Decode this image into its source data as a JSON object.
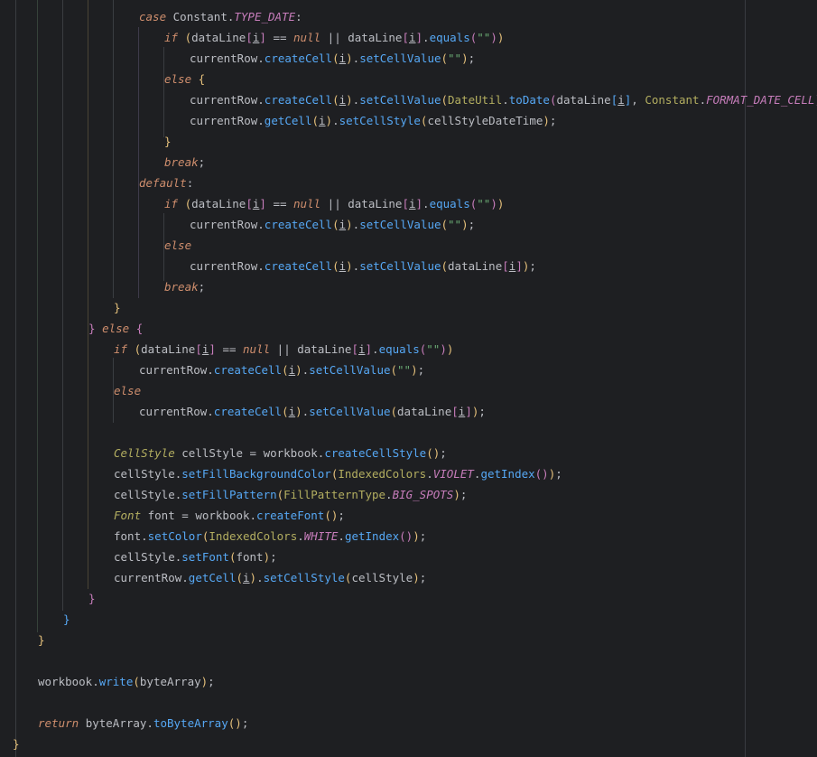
{
  "editor": {
    "language": "java",
    "colors": {
      "background": "#1e1f22",
      "text": "#bcbec4",
      "keyword": "#cf8e6d",
      "method": "#56a8f5",
      "string": "#6aab73",
      "static_field": "#c77dbb"
    },
    "lines": [
      {
        "t": [
          [
            "kwi",
            "case "
          ],
          [
            "cls",
            "Constant."
          ],
          [
            "sfld",
            "TYPE_DATE"
          ],
          [
            "cls",
            ":"
          ]
        ]
      },
      {
        "t": [
          [
            "kwi",
            "if "
          ],
          [
            "br-gold",
            "("
          ],
          [
            "cls",
            "dataLine"
          ],
          [
            "br-purple",
            "["
          ],
          [
            "u",
            "i"
          ],
          [
            "br-purple",
            "]"
          ],
          [
            "cls",
            " == "
          ],
          [
            "null",
            "null"
          ],
          [
            "cls",
            " || dataLine"
          ],
          [
            "br-purple",
            "["
          ],
          [
            "u",
            "i"
          ],
          [
            "br-purple",
            "]"
          ],
          [
            "cls",
            "."
          ],
          [
            "m",
            "equals"
          ],
          [
            "br-purple",
            "("
          ],
          [
            "str",
            "\"\""
          ],
          [
            "br-purple",
            ")"
          ],
          [
            "br-gold",
            ")"
          ]
        ]
      },
      {
        "t": [
          [
            "cls",
            "currentRow."
          ],
          [
            "m",
            "createCell"
          ],
          [
            "br-gold",
            "("
          ],
          [
            "u",
            "i"
          ],
          [
            "br-gold",
            ")"
          ],
          [
            "cls",
            "."
          ],
          [
            "m",
            "setCellValue"
          ],
          [
            "br-gold",
            "("
          ],
          [
            "str",
            "\"\""
          ],
          [
            "br-gold",
            ")"
          ],
          [
            "cls",
            ";"
          ]
        ]
      },
      {
        "t": [
          [
            "kwi",
            "else "
          ],
          [
            "br-gold",
            "{"
          ]
        ]
      },
      {
        "t": [
          [
            "cls",
            "currentRow."
          ],
          [
            "m",
            "createCell"
          ],
          [
            "br-gold",
            "("
          ],
          [
            "u",
            "i"
          ],
          [
            "br-gold",
            ")"
          ],
          [
            "cls",
            "."
          ],
          [
            "m",
            "setCellValue"
          ],
          [
            "br-gold",
            "("
          ],
          [
            "ann",
            "DateUtil"
          ],
          [
            "cls",
            "."
          ],
          [
            "m",
            "toDate"
          ],
          [
            "br-purple",
            "("
          ],
          [
            "cls",
            "dataLine"
          ],
          [
            "br-blue",
            "["
          ],
          [
            "u",
            "i"
          ],
          [
            "br-blue",
            "]"
          ],
          [
            "cls",
            ", "
          ],
          [
            "ann",
            "Constant"
          ],
          [
            "cls",
            "."
          ],
          [
            "sfld",
            "FORMAT_DATE_CELL"
          ],
          [
            "br-purple",
            ")"
          ],
          [
            "br-gold",
            ")"
          ],
          [
            "cls",
            ";"
          ]
        ]
      },
      {
        "t": [
          [
            "cls",
            "currentRow."
          ],
          [
            "m",
            "getCell"
          ],
          [
            "br-gold",
            "("
          ],
          [
            "u",
            "i"
          ],
          [
            "br-gold",
            ")"
          ],
          [
            "cls",
            "."
          ],
          [
            "m",
            "setCellStyle"
          ],
          [
            "br-gold",
            "("
          ],
          [
            "cls",
            "cellStyleDateTime"
          ],
          [
            "br-gold",
            ")"
          ],
          [
            "cls",
            ";"
          ]
        ]
      },
      {
        "t": [
          [
            "br-gold",
            "}"
          ]
        ]
      },
      {
        "t": [
          [
            "kwi",
            "break"
          ],
          [
            "cls",
            ";"
          ]
        ]
      },
      {
        "t": [
          [
            "kwi",
            "default"
          ],
          [
            "cls",
            ":"
          ]
        ]
      },
      {
        "t": [
          [
            "kwi",
            "if "
          ],
          [
            "br-gold",
            "("
          ],
          [
            "cls",
            "dataLine"
          ],
          [
            "br-purple",
            "["
          ],
          [
            "u",
            "i"
          ],
          [
            "br-purple",
            "]"
          ],
          [
            "cls",
            " == "
          ],
          [
            "null",
            "null"
          ],
          [
            "cls",
            " || dataLine"
          ],
          [
            "br-purple",
            "["
          ],
          [
            "u",
            "i"
          ],
          [
            "br-purple",
            "]"
          ],
          [
            "cls",
            "."
          ],
          [
            "m",
            "equals"
          ],
          [
            "br-purple",
            "("
          ],
          [
            "str",
            "\"\""
          ],
          [
            "br-purple",
            ")"
          ],
          [
            "br-gold",
            ")"
          ]
        ]
      },
      {
        "t": [
          [
            "cls",
            "currentRow."
          ],
          [
            "m",
            "createCell"
          ],
          [
            "br-gold",
            "("
          ],
          [
            "u",
            "i"
          ],
          [
            "br-gold",
            ")"
          ],
          [
            "cls",
            "."
          ],
          [
            "m",
            "setCellValue"
          ],
          [
            "br-gold",
            "("
          ],
          [
            "str",
            "\"\""
          ],
          [
            "br-gold",
            ")"
          ],
          [
            "cls",
            ";"
          ]
        ]
      },
      {
        "t": [
          [
            "kwi",
            "else"
          ]
        ]
      },
      {
        "t": [
          [
            "cls",
            "currentRow."
          ],
          [
            "m",
            "createCell"
          ],
          [
            "br-gold",
            "("
          ],
          [
            "u",
            "i"
          ],
          [
            "br-gold",
            ")"
          ],
          [
            "cls",
            "."
          ],
          [
            "m",
            "setCellValue"
          ],
          [
            "br-gold",
            "("
          ],
          [
            "cls",
            "dataLine"
          ],
          [
            "br-purple",
            "["
          ],
          [
            "u",
            "i"
          ],
          [
            "br-purple",
            "]"
          ],
          [
            "br-gold",
            ")"
          ],
          [
            "cls",
            ";"
          ]
        ]
      },
      {
        "t": [
          [
            "kwi",
            "break"
          ],
          [
            "cls",
            ";"
          ]
        ]
      },
      {
        "t": [
          [
            "br-gold",
            "}"
          ]
        ]
      },
      {
        "t": [
          [
            "br-purple",
            "} "
          ],
          [
            "kwi",
            "else "
          ],
          [
            "br-purple",
            "{"
          ]
        ]
      },
      {
        "t": [
          [
            "kwi",
            "if "
          ],
          [
            "br-gold",
            "("
          ],
          [
            "cls",
            "dataLine"
          ],
          [
            "br-purple",
            "["
          ],
          [
            "u",
            "i"
          ],
          [
            "br-purple",
            "]"
          ],
          [
            "cls",
            " == "
          ],
          [
            "null",
            "null"
          ],
          [
            "cls",
            " || dataLine"
          ],
          [
            "br-purple",
            "["
          ],
          [
            "u",
            "i"
          ],
          [
            "br-purple",
            "]"
          ],
          [
            "cls",
            "."
          ],
          [
            "m",
            "equals"
          ],
          [
            "br-purple",
            "("
          ],
          [
            "str",
            "\"\""
          ],
          [
            "br-purple",
            ")"
          ],
          [
            "br-gold",
            ")"
          ]
        ]
      },
      {
        "t": [
          [
            "cls",
            "currentRow."
          ],
          [
            "m",
            "createCell"
          ],
          [
            "br-gold",
            "("
          ],
          [
            "u",
            "i"
          ],
          [
            "br-gold",
            ")"
          ],
          [
            "cls",
            "."
          ],
          [
            "m",
            "setCellValue"
          ],
          [
            "br-gold",
            "("
          ],
          [
            "str",
            "\"\""
          ],
          [
            "br-gold",
            ")"
          ],
          [
            "cls",
            ";"
          ]
        ]
      },
      {
        "t": [
          [
            "kwi",
            "else"
          ]
        ]
      },
      {
        "t": [
          [
            "cls",
            "currentRow."
          ],
          [
            "m",
            "createCell"
          ],
          [
            "br-gold",
            "("
          ],
          [
            "u",
            "i"
          ],
          [
            "br-gold",
            ")"
          ],
          [
            "cls",
            "."
          ],
          [
            "m",
            "setCellValue"
          ],
          [
            "br-gold",
            "("
          ],
          [
            "cls",
            "dataLine"
          ],
          [
            "br-purple",
            "["
          ],
          [
            "u",
            "i"
          ],
          [
            "br-purple",
            "]"
          ],
          [
            "br-gold",
            ")"
          ],
          [
            "cls",
            ";"
          ]
        ]
      },
      {
        "t": []
      },
      {
        "t": [
          [
            "italic-class",
            "CellStyle"
          ],
          [
            "cls",
            " cellStyle = workbook."
          ],
          [
            "m",
            "createCellStyle"
          ],
          [
            "br-gold",
            "()"
          ],
          [
            "cls",
            ";"
          ]
        ]
      },
      {
        "t": [
          [
            "cls",
            "cellStyle."
          ],
          [
            "m",
            "setFillBackgroundColor"
          ],
          [
            "br-gold",
            "("
          ],
          [
            "ann",
            "IndexedColors"
          ],
          [
            "cls",
            "."
          ],
          [
            "sfld",
            "VIOLET"
          ],
          [
            "cls",
            "."
          ],
          [
            "m",
            "getIndex"
          ],
          [
            "br-purple",
            "()"
          ],
          [
            "br-gold",
            ")"
          ],
          [
            "cls",
            ";"
          ]
        ]
      },
      {
        "t": [
          [
            "cls",
            "cellStyle."
          ],
          [
            "m",
            "setFillPattern"
          ],
          [
            "br-gold",
            "("
          ],
          [
            "ann",
            "FillPatternType"
          ],
          [
            "cls",
            "."
          ],
          [
            "sfld",
            "BIG_SPOTS"
          ],
          [
            "br-gold",
            ")"
          ],
          [
            "cls",
            ";"
          ]
        ]
      },
      {
        "t": [
          [
            "italic-class",
            "Font"
          ],
          [
            "cls",
            " font = workbook."
          ],
          [
            "m",
            "createFont"
          ],
          [
            "br-gold",
            "()"
          ],
          [
            "cls",
            ";"
          ]
        ]
      },
      {
        "t": [
          [
            "cls",
            "font."
          ],
          [
            "m",
            "setColor"
          ],
          [
            "br-gold",
            "("
          ],
          [
            "ann",
            "IndexedColors"
          ],
          [
            "cls",
            "."
          ],
          [
            "sfld",
            "WHITE"
          ],
          [
            "cls",
            "."
          ],
          [
            "m",
            "getIndex"
          ],
          [
            "br-purple",
            "()"
          ],
          [
            "br-gold",
            ")"
          ],
          [
            "cls",
            ";"
          ]
        ]
      },
      {
        "t": [
          [
            "cls",
            "cellStyle."
          ],
          [
            "m",
            "setFont"
          ],
          [
            "br-gold",
            "("
          ],
          [
            "cls",
            "font"
          ],
          [
            "br-gold",
            ")"
          ],
          [
            "cls",
            ";"
          ]
        ]
      },
      {
        "t": [
          [
            "cls",
            "currentRow."
          ],
          [
            "m",
            "getCell"
          ],
          [
            "br-gold",
            "("
          ],
          [
            "u",
            "i"
          ],
          [
            "br-gold",
            ")"
          ],
          [
            "cls",
            "."
          ],
          [
            "m",
            "setCellStyle"
          ],
          [
            "br-gold",
            "("
          ],
          [
            "cls",
            "cellStyle"
          ],
          [
            "br-gold",
            ")"
          ],
          [
            "cls",
            ";"
          ]
        ]
      },
      {
        "t": [
          [
            "br-purple",
            "}"
          ]
        ]
      },
      {
        "t": [
          [
            "br-blue",
            "}"
          ]
        ]
      },
      {
        "t": [
          [
            "br-gold",
            "}"
          ]
        ]
      },
      {
        "t": []
      },
      {
        "t": [
          [
            "cls",
            "workbook."
          ],
          [
            "m",
            "write"
          ],
          [
            "br-gold",
            "("
          ],
          [
            "cls",
            "byteArray"
          ],
          [
            "br-gold",
            ")"
          ],
          [
            "cls",
            ";"
          ]
        ]
      },
      {
        "t": []
      },
      {
        "t": [
          [
            "kwi",
            "return "
          ],
          [
            "cls",
            "byteArray."
          ],
          [
            "m",
            "toByteArray"
          ],
          [
            "br-gold",
            "()"
          ],
          [
            "cls",
            ";"
          ]
        ]
      },
      {
        "t": [
          [
            "br-gold",
            "}"
          ]
        ]
      }
    ]
  }
}
